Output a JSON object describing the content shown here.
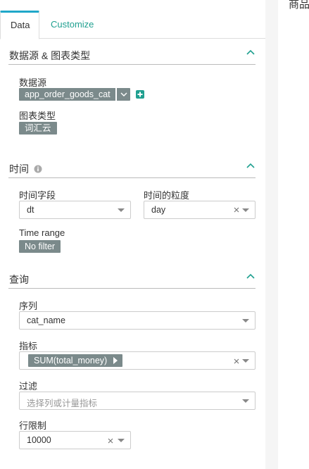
{
  "tabs": {
    "data": "Data",
    "customize": "Customize"
  },
  "canvas": {
    "title_fragment": "商品"
  },
  "section_datasource": {
    "title": "数据源 & 图表类型",
    "datasource_label": "数据源",
    "datasource_value": "app_order_goods_cat",
    "charttype_label": "图表类型",
    "charttype_value": "词汇云"
  },
  "section_time": {
    "title": "时间",
    "time_column_label": "时间字段",
    "time_column_value": "dt",
    "time_grain_label": "时间的粒度",
    "time_grain_value": "day",
    "time_range_label": "Time range",
    "time_range_value": "No filter"
  },
  "section_query": {
    "title": "查询",
    "series_label": "序列",
    "series_value": "cat_name",
    "metric_label": "指标",
    "metric_value": "SUM(total_money)",
    "filter_label": "过滤",
    "filter_placeholder": "选择列或计量指标",
    "row_limit_label": "行限制",
    "row_limit_value": "10000"
  },
  "colors": {
    "accent": "#20a090",
    "tag": "#7b8a8b",
    "tab_active_top": "#20a7c9"
  }
}
